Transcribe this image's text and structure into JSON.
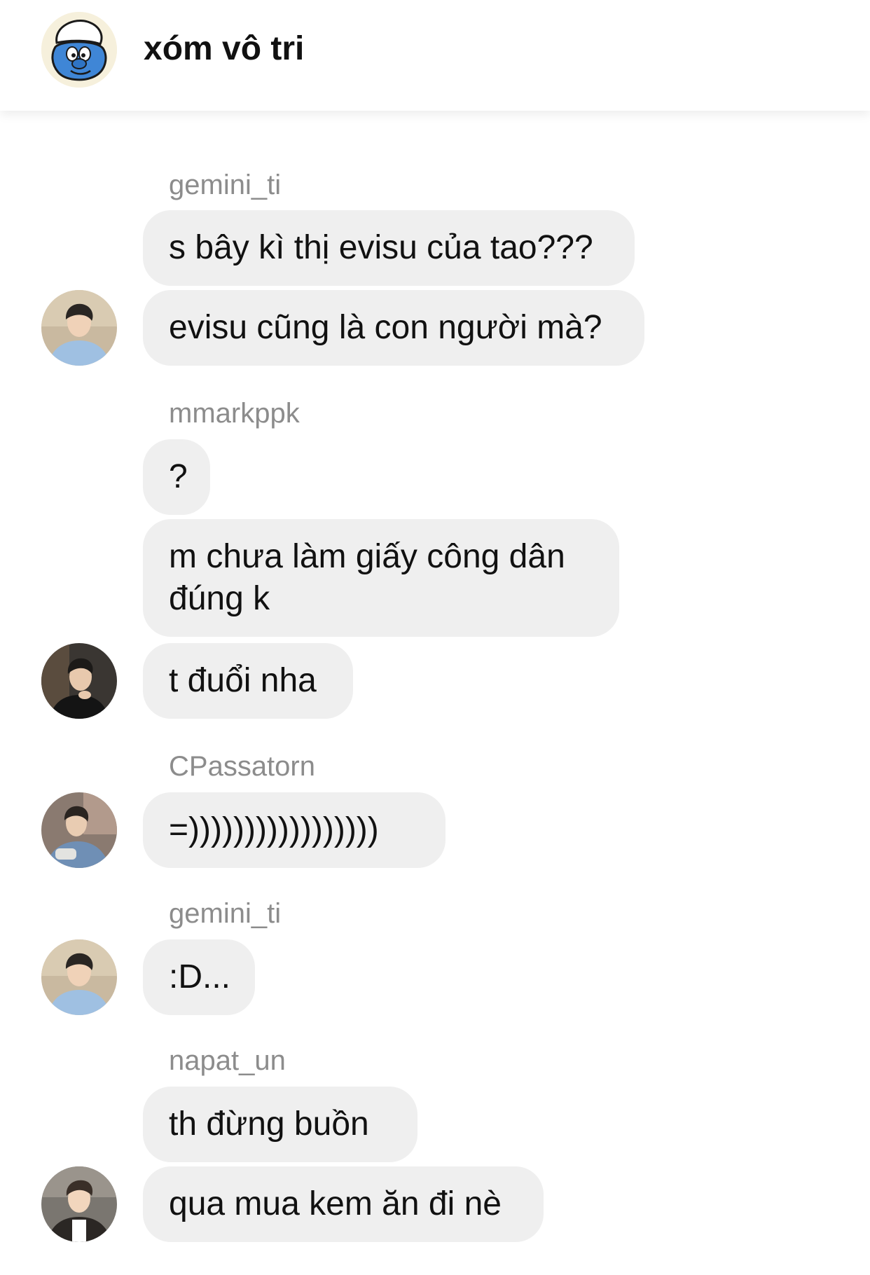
{
  "header": {
    "title": "xóm vô tri",
    "avatar_icon": "smurf-avatar-icon"
  },
  "messages": [
    {
      "sender": "gemini_ti",
      "bubbles": [
        "s bây kì thị evisu của tao???",
        "evisu cũng là con người mà?"
      ]
    },
    {
      "sender": "mmarkppk",
      "bubbles": [
        "?",
        "m chưa làm giấy công dân đúng k",
        "t đuổi nha"
      ]
    },
    {
      "sender": "CPassatorn",
      "bubbles": [
        "=)))))))))))))))))"
      ]
    },
    {
      "sender": "gemini_ti",
      "bubbles": [
        ":D..."
      ]
    },
    {
      "sender": "napat_un",
      "bubbles": [
        "th đừng buồn",
        "qua mua kem ăn đi nè"
      ]
    }
  ],
  "colors": {
    "bubble_bg": "#efefef",
    "sender_text": "#8c8c8c",
    "message_text": "#111111",
    "header_bg": "#ffffff"
  }
}
